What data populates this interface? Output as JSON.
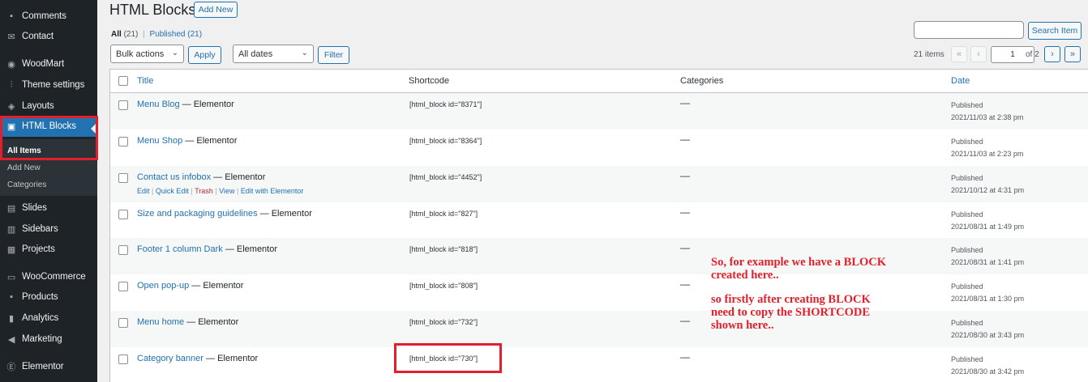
{
  "sidebar": {
    "items": [
      {
        "label": "Comments",
        "icon": "comments-icon"
      },
      {
        "label": "Contact",
        "icon": "mail-icon"
      },
      {
        "label": "WoodMart",
        "icon": "woodmart-icon"
      },
      {
        "label": "Theme settings",
        "icon": "sliders-icon"
      },
      {
        "label": "Layouts",
        "icon": "layers-icon"
      },
      {
        "label": "HTML Blocks",
        "icon": "html-block-icon"
      },
      {
        "label": "Slides",
        "icon": "slides-icon"
      },
      {
        "label": "Sidebars",
        "icon": "sidebars-icon"
      },
      {
        "label": "Projects",
        "icon": "portfolio-icon"
      },
      {
        "label": "WooCommerce",
        "icon": "woocommerce-icon"
      },
      {
        "label": "Products",
        "icon": "archive-icon"
      },
      {
        "label": "Analytics",
        "icon": "bar-chart-icon"
      },
      {
        "label": "Marketing",
        "icon": "megaphone-icon"
      },
      {
        "label": "Elementor",
        "icon": "elementor-icon"
      }
    ],
    "submenu": [
      "All Items",
      "Add New",
      "Categories"
    ]
  },
  "header": {
    "title": "HTML Blocks",
    "add_new": "Add New"
  },
  "views": {
    "all_label": "All",
    "all_count": "(21)",
    "sep": "|",
    "published_label": "Published",
    "published_count": "(21)"
  },
  "filters": {
    "bulk_actions": "Bulk actions",
    "apply": "Apply",
    "all_dates": "All dates",
    "filter": "Filter"
  },
  "search": {
    "button": "Search Item",
    "value": ""
  },
  "pagination": {
    "items": "21 items",
    "first": "«",
    "prev": "‹",
    "current": "1",
    "of": "of 2",
    "next": "›",
    "last": "»"
  },
  "table": {
    "columns": [
      "Title",
      "Shortcode",
      "Categories",
      "Date"
    ],
    "rows": [
      {
        "title": "Menu Blog",
        "suffix": " — Elementor",
        "shortcode": "[html_block id=\"8371\"]",
        "category": "—",
        "status": "Published",
        "date": "2021/11/03 at 2:38 pm"
      },
      {
        "title": "Menu Shop",
        "suffix": " — Elementor",
        "shortcode": "[html_block id=\"8364\"]",
        "category": "—",
        "status": "Published",
        "date": "2021/11/03 at 2:23 pm"
      },
      {
        "title": "Contact us infobox",
        "suffix": " — Elementor",
        "shortcode": "[html_block id=\"4452\"]",
        "category": "—",
        "status": "Published",
        "date": "2021/10/12 at 4:31 pm"
      },
      {
        "title": "Size and packaging guidelines",
        "suffix": " — Elementor",
        "shortcode": "[html_block id=\"827\"]",
        "category": "—",
        "status": "Published",
        "date": "2021/08/31 at 1:49 pm"
      },
      {
        "title": "Footer 1 column Dark",
        "suffix": " — Elementor",
        "shortcode": "[html_block id=\"818\"]",
        "category": "—",
        "status": "Published",
        "date": "2021/08/31 at 1:41 pm"
      },
      {
        "title": "Open pop-up",
        "suffix": " — Elementor",
        "shortcode": "[html_block id=\"808\"]",
        "category": "—",
        "status": "Published",
        "date": "2021/08/31 at 1:30 pm"
      },
      {
        "title": "Menu home",
        "suffix": " — Elementor",
        "shortcode": "[html_block id=\"732\"]",
        "category": "—",
        "status": "Published",
        "date": "2021/08/30 at 3:43 pm"
      },
      {
        "title": "Category banner",
        "suffix": " — Elementor",
        "shortcode": "[html_block id=\"730\"]",
        "category": "—",
        "status": "Published",
        "date": "2021/08/30 at 3:42 pm"
      }
    ],
    "row_actions": {
      "edit": "Edit",
      "quick_edit": "Quick Edit",
      "trash": "Trash",
      "view": "View",
      "edit_elementor": "Edit with Elementor",
      "sep": "|"
    }
  },
  "annotation": {
    "line1": "So, for example we have a BLOCK",
    "line2": "created here..",
    "line3": "so firstly after creating BLOCK",
    "line4": "need to copy the SHORTCODE",
    "line5": "shown here.."
  },
  "colors": {
    "sidebar_bg": "#1d2327",
    "active_menu": "#2271b1",
    "link": "#2271b1",
    "highlight_red": "#e21f2a"
  }
}
